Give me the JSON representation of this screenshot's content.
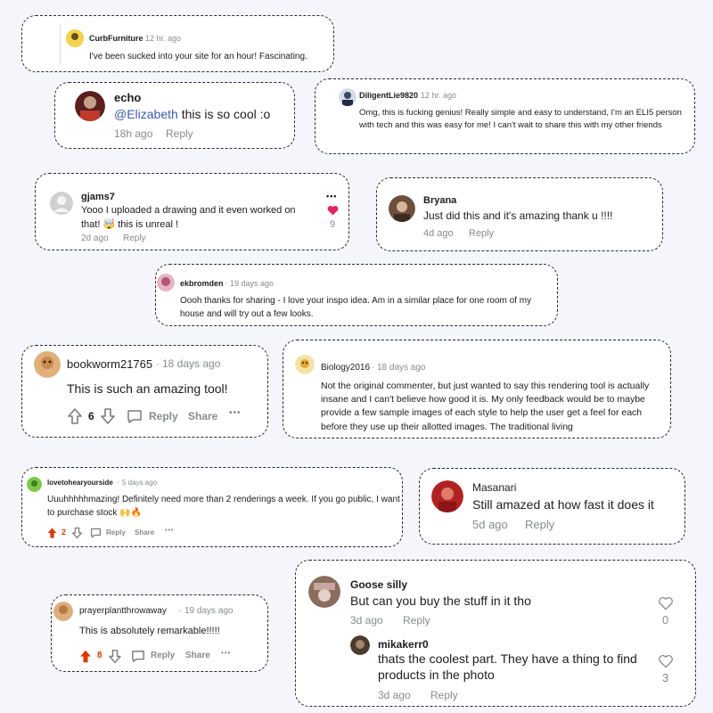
{
  "c1": {
    "username": "CurbFurniture",
    "time": "12 hr. ago",
    "text": "I've been sucked into your site for an hour! Fascinating."
  },
  "c2": {
    "username": "echo",
    "mention": "@Elizabeth",
    "text": " this is so cool :o",
    "time": "18h ago",
    "reply": "Reply"
  },
  "c3": {
    "username": "DiligentLie9820",
    "time": "12 hr. ago",
    "text": "Omg, this is fucking genius! Really simple and easy to understand, I'm an ELI5 person with tech and this was easy for me! I can't wait to share this with my other friends"
  },
  "c4": {
    "username": "gjams7",
    "text": "Yooo I uploaded a drawing and it even worked on that! 🤯 this is unreal !",
    "time": "2d ago",
    "reply": "Reply",
    "likes": "9",
    "more": "•••"
  },
  "c5": {
    "username": "Bryana",
    "text": "Just did this and it's amazing thank u !!!!",
    "time": "4d ago",
    "reply": "Reply"
  },
  "c6": {
    "username": "ekbromden",
    "time": "19 days ago",
    "text": "Oooh thanks for sharing - I love your inspo idea. Am in a similar place for one room of my house and will try out a few looks."
  },
  "c7": {
    "username": "bookworm21765",
    "time": "18 days ago",
    "text": "This is such an amazing tool!",
    "votes": "6",
    "reply": "Reply",
    "share": "Share",
    "more": "•••"
  },
  "c8": {
    "username": "Biology2016",
    "time": "18 days ago",
    "text": "Not the original commenter, but just wanted to say this rendering tool is actually insane and I can't believe how good it is. My only feedback would be to maybe provide a few sample images of each style to help the user get a feel for each before they use up their allotted images. The traditional living"
  },
  "c9": {
    "username": "lovetohearyourside",
    "time": "5 days ago",
    "text": "Uuuhhhhhmazing! Definitely need more than 2 renderings a week. If you go public, I want to purchase stock 🙌🔥",
    "votes": "2",
    "reply": "Reply",
    "share": "Share",
    "more": "•••"
  },
  "c10": {
    "username": "Masanari",
    "text": "Still amazed at how fast it does it",
    "time": "5d ago",
    "reply": "Reply"
  },
  "c11": {
    "username": "prayerplantthrowaway",
    "time": "19 days ago",
    "text": "This is absolutely remarkable!!!!!",
    "votes": "8",
    "reply": "Reply",
    "share": "Share",
    "more": "•••"
  },
  "c12": {
    "username": "Goose silly",
    "text": "But can you buy the stuff in it tho",
    "time": "3d ago",
    "reply": "Reply",
    "likes": "0",
    "sub": {
      "username": "mikakerr0",
      "text": "thats the coolest part. They have a thing to find products in the photo",
      "time": "3d ago",
      "reply": "Reply",
      "likes": "3"
    }
  },
  "sep": "·",
  "colors": {
    "upvote_active": "#d93a00",
    "heart": "#e0245e",
    "mention": "#3b5ba9",
    "meta": "#878a8c"
  }
}
